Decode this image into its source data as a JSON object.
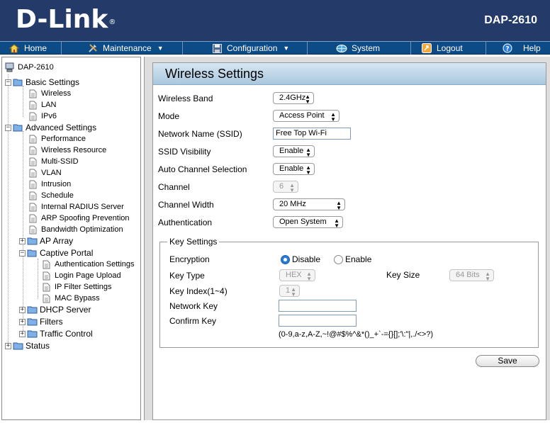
{
  "header": {
    "brand": "D-Link",
    "trademark": "®",
    "model": "DAP-2610"
  },
  "menu": {
    "home": "Home",
    "maintenance": "Maintenance",
    "configuration": "Configuration",
    "system": "System",
    "logout": "Logout",
    "help": "Help"
  },
  "tree": {
    "root": "DAP-2610",
    "basic": "Basic Settings",
    "basic_items": [
      "Wireless",
      "LAN",
      "IPv6"
    ],
    "advanced": "Advanced Settings",
    "advanced_items": [
      "Performance",
      "Wireless Resource",
      "Multi-SSID",
      "VLAN",
      "Intrusion",
      "Schedule",
      "Internal RADIUS Server",
      "ARP Spoofing Prevention",
      "Bandwidth Optimization"
    ],
    "ap_array": "AP Array",
    "captive_portal": "Captive Portal",
    "captive_items": [
      "Authentication Settings",
      "Login Page Upload",
      "IP Filter Settings",
      "MAC Bypass"
    ],
    "dhcp": "DHCP Server",
    "filters": "Filters",
    "traffic": "Traffic Control",
    "status": "Status"
  },
  "panel": {
    "title": "Wireless Settings",
    "fields": {
      "band_label": "Wireless Band",
      "band_value": "2.4GHz",
      "mode_label": "Mode",
      "mode_value": "Access Point",
      "ssid_label": "Network Name (SSID)",
      "ssid_value": "Free Top Wi-Fi",
      "visibility_label": "SSID Visibility",
      "visibility_value": "Enable",
      "autochan_label": "Auto Channel Selection",
      "autochan_value": "Enable",
      "channel_label": "Channel",
      "channel_value": "6",
      "width_label": "Channel Width",
      "width_value": "20 MHz",
      "auth_label": "Authentication",
      "auth_value": "Open System"
    },
    "key": {
      "legend": "Key Settings",
      "encryption_label": "Encryption",
      "disable": "Disable",
      "enable": "Enable",
      "encryption_selected": "Disable",
      "keytype_label": "Key Type",
      "keytype_value": "HEX",
      "keysize_label": "Key Size",
      "keysize_value": "64 Bits",
      "keyindex_label": "Key Index(1~4)",
      "keyindex_value": "1",
      "netkey_label": "Network Key",
      "netkey_value": "",
      "confirm_label": "Confirm Key",
      "confirm_value": "",
      "charset_hint": "(0-9,a-z,A-Z,~!@#$%^&*()_+`-={}[];'\\:\"|,./<>?)"
    },
    "save": "Save"
  }
}
